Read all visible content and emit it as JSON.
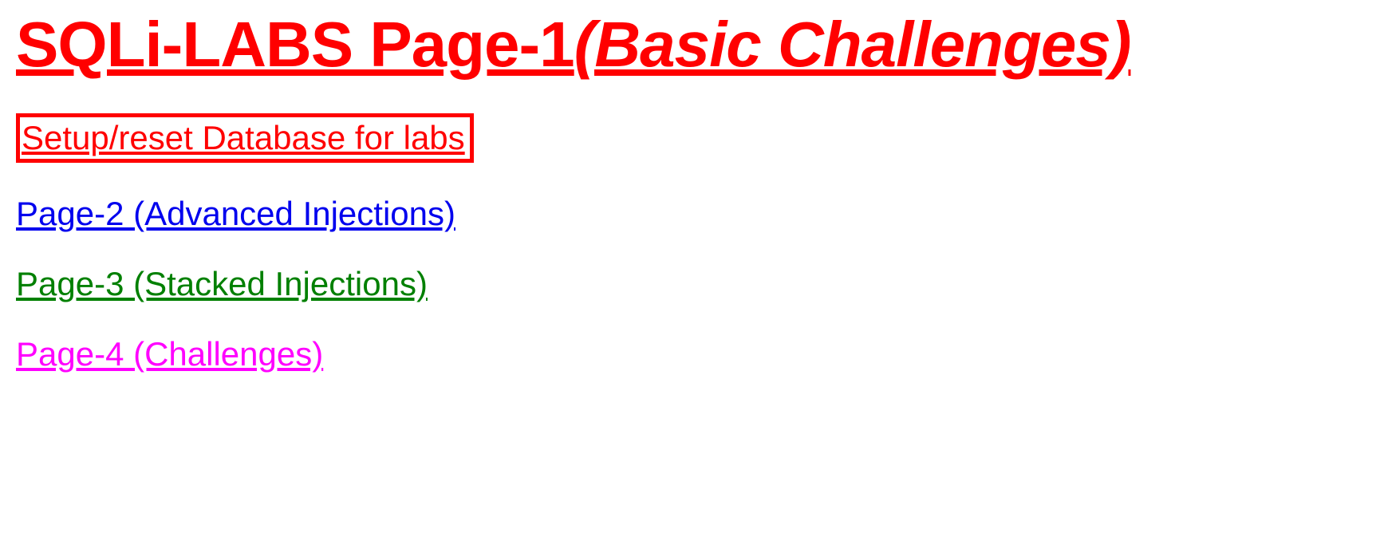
{
  "header": {
    "title_main": "SQLi-LABS Page-1",
    "title_sub": "(Basic Challenges)"
  },
  "links": {
    "setup": "Setup/reset Database for labs",
    "page2": "Page-2 (Advanced Injections)",
    "page3": "Page-3 (Stacked Injections)",
    "page4": "Page-4 (Challenges)"
  }
}
